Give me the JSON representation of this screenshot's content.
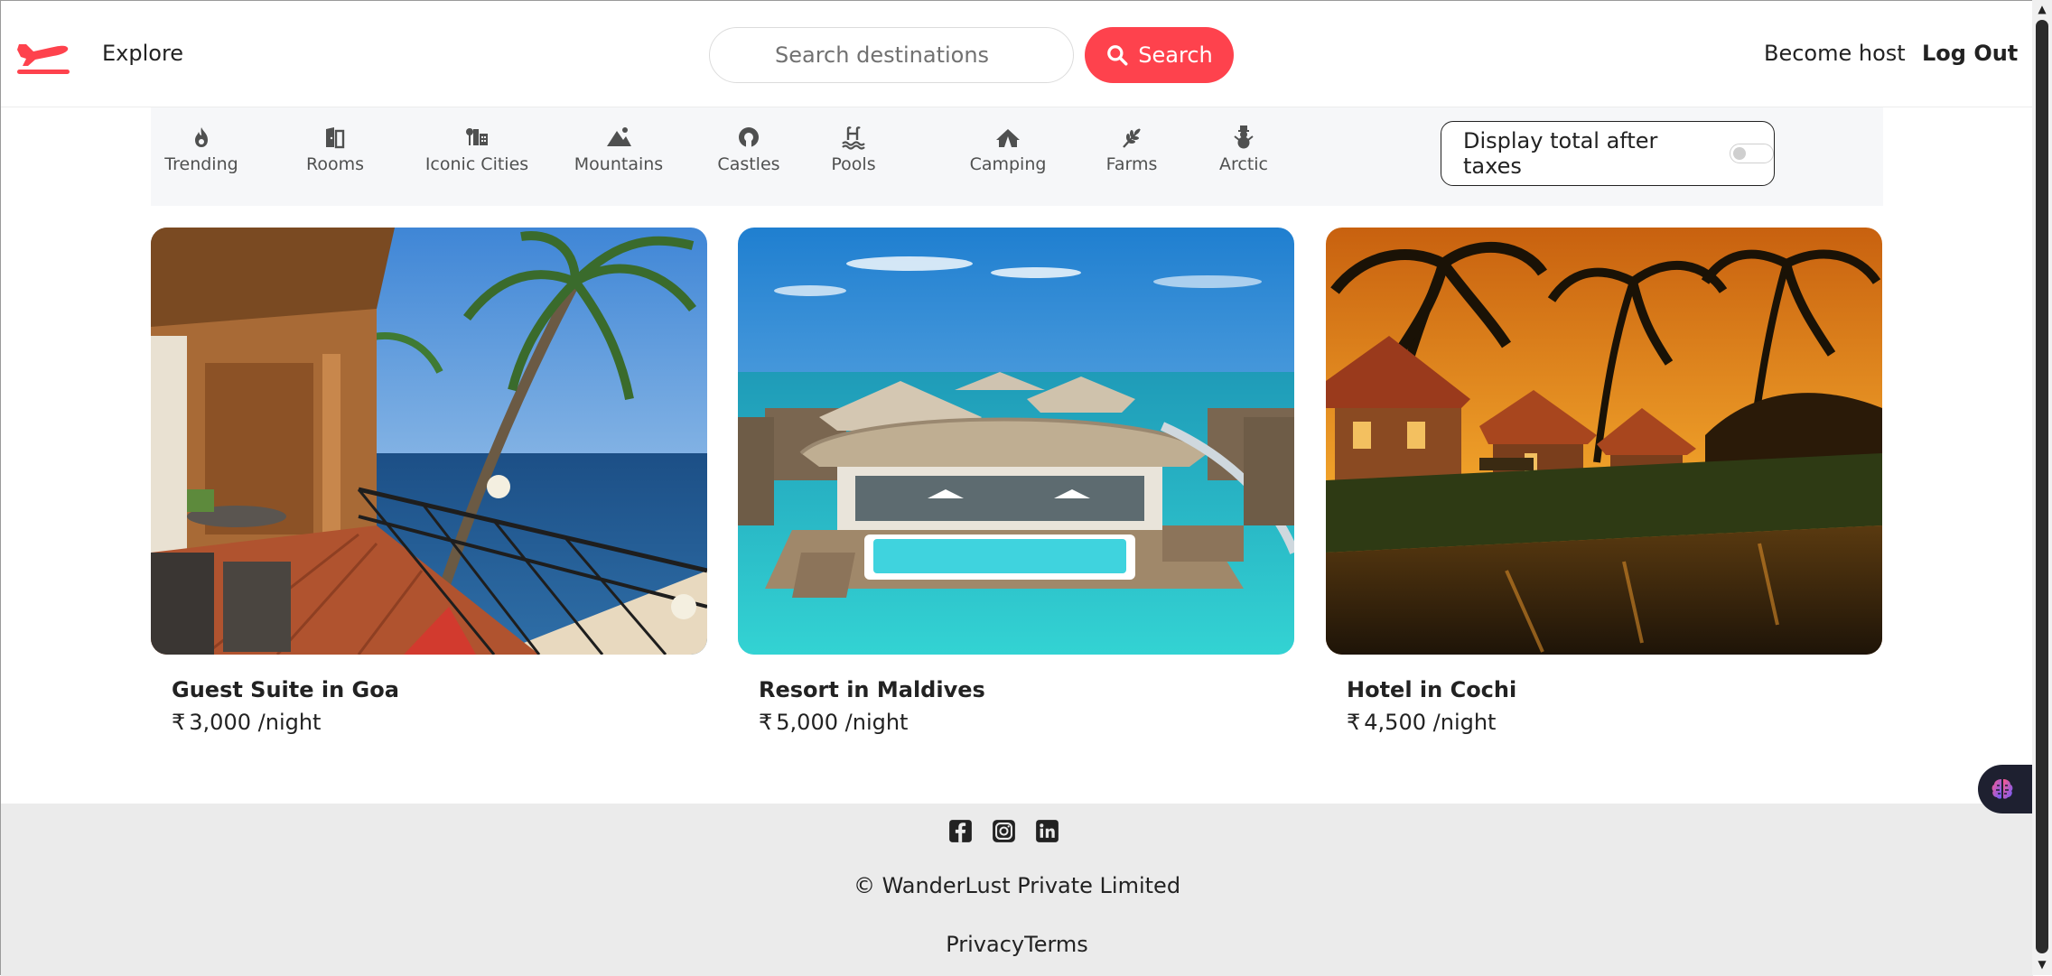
{
  "navbar": {
    "explore_label": "Explore",
    "search_placeholder": "Search destinations",
    "search_button_label": "Search",
    "become_host_label": "Become host",
    "logout_label": "Log Out",
    "brand_color": "#fe424d"
  },
  "filters": [
    {
      "label": "Trending",
      "icon": "fire-icon"
    },
    {
      "label": "Rooms",
      "icon": "bed-door-icon"
    },
    {
      "label": "Iconic Cities",
      "icon": "city-icon"
    },
    {
      "label": "Mountains",
      "icon": "mountain-icon"
    },
    {
      "label": "Castles",
      "icon": "fort-icon"
    },
    {
      "label": "Pools",
      "icon": "pool-icon"
    },
    {
      "label": "Camping",
      "icon": "campground-icon"
    },
    {
      "label": "Farms",
      "icon": "wheat-icon"
    },
    {
      "label": "Arctic",
      "icon": "snowman-icon"
    }
  ],
  "tax_toggle": {
    "label": "Display total after taxes",
    "enabled": false
  },
  "listings": [
    {
      "title": "Guest Suite in Goa",
      "currency": "₹",
      "price": "3,000",
      "unit": "/night"
    },
    {
      "title": "Resort in Maldives",
      "currency": "₹",
      "price": "5,000",
      "unit": "/night"
    },
    {
      "title": "Hotel in Cochi",
      "currency": "₹",
      "price": "4,500",
      "unit": "/night"
    }
  ],
  "footer": {
    "socials": [
      "facebook-icon",
      "instagram-icon",
      "linkedin-icon"
    ],
    "copyright": "© WanderLust Private Limited",
    "links": [
      "Privacy",
      "Terms"
    ]
  }
}
